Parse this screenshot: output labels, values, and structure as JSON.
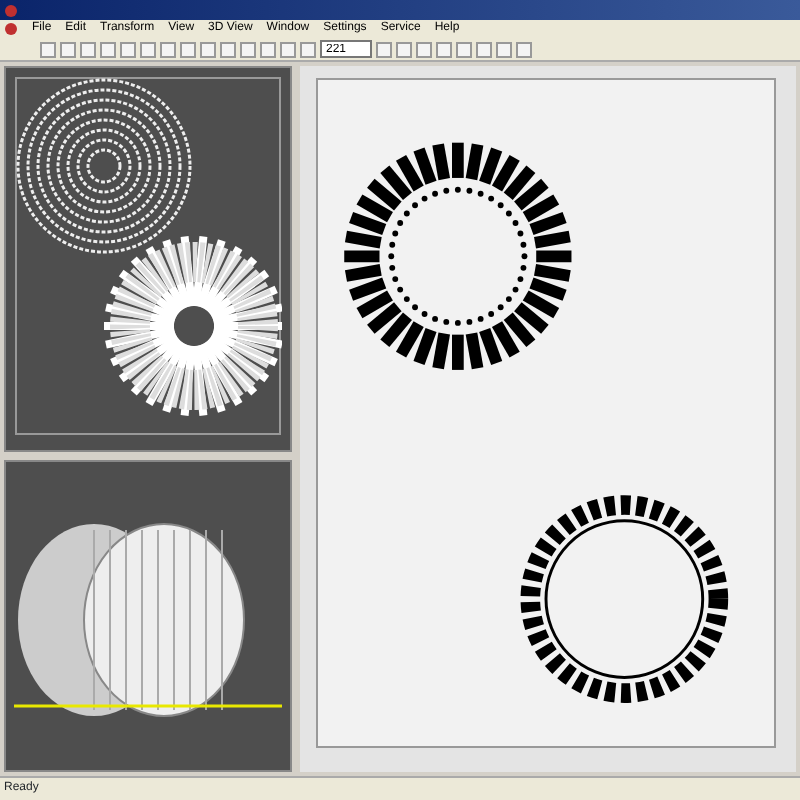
{
  "menu": [
    "File",
    "Edit",
    "Transform",
    "View",
    "3D View",
    "Window",
    "Settings",
    "Service",
    "Help"
  ],
  "toolbar": {
    "value_field": "221"
  },
  "status_bar": "Ready"
}
